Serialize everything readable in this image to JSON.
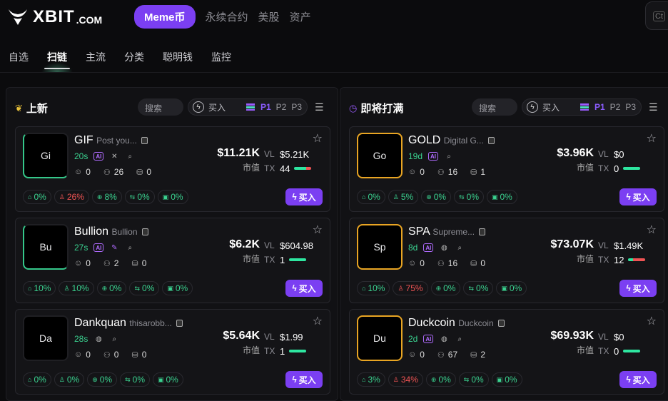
{
  "brand": {
    "name": "XBIT",
    "suffix": ".COM"
  },
  "nav": {
    "tabs": [
      {
        "label": "Meme币",
        "active": true
      },
      {
        "label": "永续合约"
      },
      {
        "label": "美股"
      },
      {
        "label": "资产"
      }
    ],
    "shortcut": "Ct"
  },
  "subnav": {
    "tabs": [
      {
        "label": "自选"
      },
      {
        "label": "扫链",
        "active": true
      },
      {
        "label": "主流"
      },
      {
        "label": "分类"
      },
      {
        "label": "聪明钱"
      },
      {
        "label": "监控"
      }
    ]
  },
  "panels": [
    {
      "title": "上新",
      "icon": "sprout-icon",
      "search": "搜索",
      "buy_label": "买入",
      "presets": [
        "P1",
        "P2",
        "P3"
      ],
      "active_preset": "P1",
      "cards": [
        {
          "avatar": "Gi",
          "border": "green",
          "name": "GIF",
          "sub": "Post you...",
          "age": "20s",
          "socials": [
            "ai",
            "x",
            "search"
          ],
          "holders_a": "0",
          "holders_b": "26",
          "holders_c": "0",
          "mcap": "$11.21K",
          "mcap_label": "市值",
          "vl": "$5.21K",
          "tx": "44",
          "bar": "mix",
          "badges": [
            {
              "v": "0%",
              "t": "pos"
            },
            {
              "v": "26%",
              "t": "neg"
            },
            {
              "v": "8%",
              "t": "pos"
            },
            {
              "v": "0%",
              "t": "pos"
            },
            {
              "v": "0%",
              "t": "pos"
            }
          ],
          "buy": "买入"
        },
        {
          "avatar": "Bu",
          "border": "green",
          "name": "Bullion",
          "sub": "Bullion",
          "age": "27s",
          "socials": [
            "ai",
            "feather",
            "search"
          ],
          "holders_a": "0",
          "holders_b": "2",
          "holders_c": "0",
          "mcap": "$6.2K",
          "mcap_label": "市值",
          "vl": "$604.98",
          "tx": "1",
          "bar": "green",
          "badges": [
            {
              "v": "10%",
              "t": "pos"
            },
            {
              "v": "10%",
              "t": "pos"
            },
            {
              "v": "0%",
              "t": "pos"
            },
            {
              "v": "0%",
              "t": "pos"
            },
            {
              "v": "0%",
              "t": "pos"
            }
          ],
          "buy": "买入"
        },
        {
          "avatar": "Da",
          "border": "none",
          "name": "Dankquan",
          "sub": "thisarobb...",
          "age": "28s",
          "socials": [
            "globe",
            "search"
          ],
          "holders_a": "0",
          "holders_b": "0",
          "holders_c": "0",
          "mcap": "$5.64K",
          "mcap_label": "市值",
          "vl": "$1.99",
          "tx": "1",
          "bar": "green",
          "badges": [
            {
              "v": "0%",
              "t": "pos"
            },
            {
              "v": "0%",
              "t": "pos"
            },
            {
              "v": "0%",
              "t": "pos"
            },
            {
              "v": "0%",
              "t": "pos"
            },
            {
              "v": "0%",
              "t": "pos"
            }
          ],
          "buy": "买入"
        }
      ]
    },
    {
      "title": "即将打满",
      "icon": "alarm-icon",
      "search": "搜索",
      "buy_label": "买入",
      "presets": [
        "P1",
        "P2",
        "P3"
      ],
      "active_preset": "P1",
      "cards": [
        {
          "avatar": "Go",
          "border": "gold",
          "name": "GOLD",
          "sub": "Digital G...",
          "age": "19d",
          "socials": [
            "ai",
            "search"
          ],
          "holders_a": "0",
          "holders_b": "16",
          "holders_c": "1",
          "mcap": "$3.96K",
          "mcap_label": "市值",
          "vl": "$0",
          "tx": "0",
          "bar": "green",
          "badges": [
            {
              "v": "0%",
              "t": "pos"
            },
            {
              "v": "5%",
              "t": "pos"
            },
            {
              "v": "0%",
              "t": "pos"
            },
            {
              "v": "0%",
              "t": "pos"
            },
            {
              "v": "0%",
              "t": "pos"
            }
          ],
          "buy": "买入"
        },
        {
          "avatar": "Sp",
          "border": "gold",
          "name": "SPA",
          "sub": "Supreme...",
          "age": "8d",
          "socials": [
            "ai",
            "globe",
            "search"
          ],
          "holders_a": "0",
          "holders_b": "16",
          "holders_c": "0",
          "mcap": "$73.07K",
          "mcap_label": "市值",
          "vl": "$1.49K",
          "tx": "12",
          "bar": "red",
          "badges": [
            {
              "v": "10%",
              "t": "pos"
            },
            {
              "v": "75%",
              "t": "neg"
            },
            {
              "v": "0%",
              "t": "pos"
            },
            {
              "v": "0%",
              "t": "pos"
            },
            {
              "v": "0%",
              "t": "pos"
            }
          ],
          "buy": "买入"
        },
        {
          "avatar": "Du",
          "border": "gold",
          "name": "Duckcoin",
          "sub": "Duckcoin",
          "age": "2d",
          "socials": [
            "ai",
            "globe",
            "search"
          ],
          "holders_a": "0",
          "holders_b": "67",
          "holders_c": "2",
          "mcap": "$69.93K",
          "mcap_label": "市值",
          "vl": "$0",
          "tx": "0",
          "bar": "green",
          "badges": [
            {
              "v": "3%",
              "t": "pos"
            },
            {
              "v": "34%",
              "t": "neg"
            },
            {
              "v": "0%",
              "t": "pos"
            },
            {
              "v": "0%",
              "t": "pos"
            },
            {
              "v": "0%",
              "t": "pos"
            }
          ],
          "buy": "买入"
        }
      ]
    }
  ],
  "labels": {
    "vl": "VL",
    "tx": "TX"
  },
  "colors": {
    "accent": "#7b3ff2",
    "positive": "#3ad18f",
    "negative": "#f05454",
    "gold": "#e9a523"
  }
}
